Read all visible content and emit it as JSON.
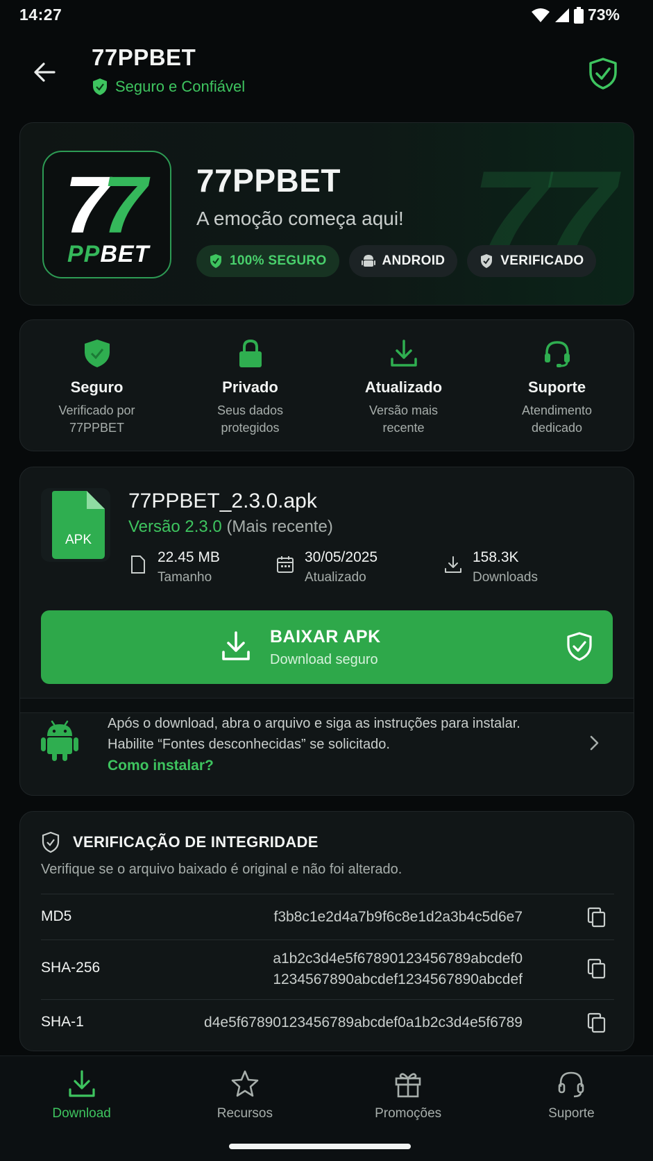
{
  "status_bar": {
    "time": "14:27",
    "battery": "73%"
  },
  "header": {
    "title": "77PPBET",
    "subtitle": "Seguro e Confiável"
  },
  "hero": {
    "logo_top": "77",
    "logo_bottom_a": "PP",
    "logo_bottom_b": "BET",
    "watermark": "77",
    "title": "77PPBET",
    "tagline": "A emoção começa aqui!",
    "chips": [
      "100% SEGURO",
      "ANDROID",
      "VERIFICADO"
    ]
  },
  "features": [
    {
      "title": "Seguro",
      "desc": "Verificado por 77PPBET",
      "icon": "shield-check-icon"
    },
    {
      "title": "Privado",
      "desc": "Seus dados protegidos",
      "icon": "lock-icon"
    },
    {
      "title": "Atualizado",
      "desc": "Versão mais recente",
      "icon": "download-icon"
    },
    {
      "title": "Suporte",
      "desc": "Atendimento dedicado",
      "icon": "headset-icon"
    }
  ],
  "apk": {
    "file_label": "APK",
    "name": "77PPBET_2.3.0.apk",
    "version": "Versão 2.3.0",
    "version_note": "(Mais recente)",
    "size_value": "22.45 MB",
    "size_label": "Tamanho",
    "date_value": "30/05/2025",
    "date_label": "Atualizado",
    "downloads_value": "158.3K",
    "downloads_label": "Downloads",
    "button_title": "BAIXAR APK",
    "button_subtitle": "Download seguro",
    "install_text": "Após o download, abra o arquivo e siga as instruções para instalar. Habilite “Fontes desconhecidas” se solicitado.",
    "install_link": "Como instalar?"
  },
  "integrity": {
    "title": "VERIFICAÇÃO DE INTEGRIDADE",
    "desc": "Verifique se o arquivo baixado é original e não foi alterado.",
    "md5_label": "MD5",
    "md5_value": "f3b8c1e2d4a7b9f6c8e1d2a3b4c5d6e7",
    "sha256_label": "SHA-256",
    "sha256_line1": "a1b2c3d4e5f67890123456789abcdef0",
    "sha256_line2": "1234567890abcdef1234567890abcdef",
    "sha1_label": "SHA-1",
    "sha1_value": "d4e5f67890123456789abcdef0a1b2c3d4e5f6789"
  },
  "nav": [
    "Download",
    "Recursos",
    "Promoções",
    "Suporte"
  ],
  "colors": {
    "accent": "#3ec45f",
    "button": "#2ea84a",
    "background": "#070a0b",
    "card": "#111617"
  }
}
